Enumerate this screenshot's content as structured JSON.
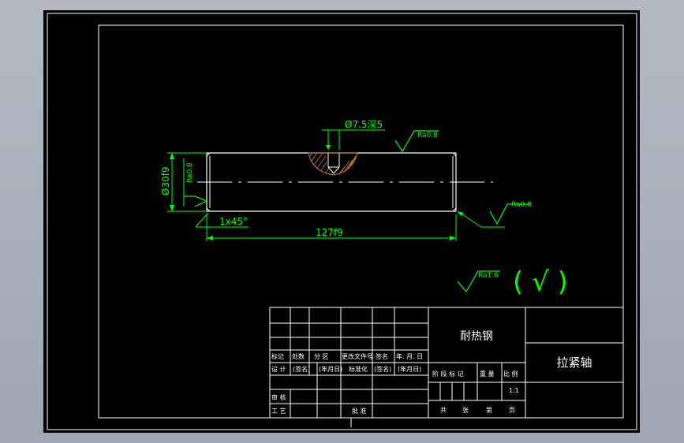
{
  "drawing": {
    "dimensions": {
      "hole": "Ø7.5深5",
      "diameter": "Ø30f9",
      "chamfer": "1x45°",
      "length": "127f9"
    },
    "roughness": {
      "top": "Ra0.8",
      "left": "Ra0.8",
      "right": "Ra0.8",
      "general": "Ra1.6",
      "general_bracket": "( √ )"
    }
  },
  "title_block": {
    "material": "耐热钢",
    "part_name": "拉紧轴",
    "row_headers": [
      "标记",
      "处数",
      "分 区",
      "更改文件号",
      "签名",
      "年. 月. 日"
    ],
    "design_row": [
      "设 计",
      "(签名)",
      "(年月日)",
      "标准化",
      "(签名)",
      "(年月日)"
    ],
    "review_label": "审 核",
    "process_label": "工 艺",
    "approve_label": "批 准",
    "stage_headers": [
      "阶 段 标 记",
      "重 量",
      "比 例"
    ],
    "scale": "1:1",
    "sheet_info": [
      "共",
      "张",
      "第",
      "页"
    ]
  },
  "colors": {
    "background": "#000000",
    "frame": "#ffffff",
    "dimension": "#00ff00",
    "hatch": "#c87832"
  }
}
